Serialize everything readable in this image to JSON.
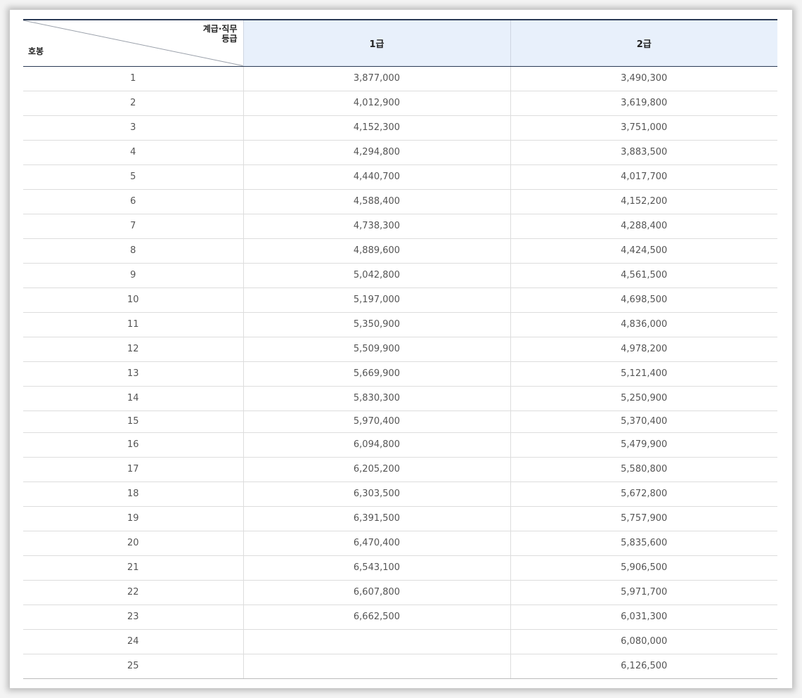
{
  "table": {
    "corner_top_line1": "계급·직무",
    "corner_top_line2": "등급",
    "corner_bottom": "호봉",
    "columns": [
      "1급",
      "2급"
    ],
    "rows": [
      {
        "step": "1",
        "grade1": "3,877,000",
        "grade2": "3,490,300"
      },
      {
        "step": "2",
        "grade1": "4,012,900",
        "grade2": "3,619,800"
      },
      {
        "step": "3",
        "grade1": "4,152,300",
        "grade2": "3,751,000"
      },
      {
        "step": "4",
        "grade1": "4,294,800",
        "grade2": "3,883,500"
      },
      {
        "step": "5",
        "grade1": "4,440,700",
        "grade2": "4,017,700"
      },
      {
        "step": "6",
        "grade1": "4,588,400",
        "grade2": "4,152,200"
      },
      {
        "step": "7",
        "grade1": "4,738,300",
        "grade2": "4,288,400"
      },
      {
        "step": "8",
        "grade1": "4,889,600",
        "grade2": "4,424,500"
      },
      {
        "step": "9",
        "grade1": "5,042,800",
        "grade2": "4,561,500"
      },
      {
        "step": "10",
        "grade1": "5,197,000",
        "grade2": "4,698,500"
      },
      {
        "step": "11",
        "grade1": "5,350,900",
        "grade2": "4,836,000"
      },
      {
        "step": "12",
        "grade1": "5,509,900",
        "grade2": "4,978,200"
      },
      {
        "step": "13",
        "grade1": "5,669,900",
        "grade2": "5,121,400"
      },
      {
        "step": "14",
        "grade1": "5,830,300",
        "grade2": "5,250,900"
      },
      {
        "step": "15",
        "grade1": "5,970,400",
        "grade2": "5,370,400"
      },
      {
        "step": "16",
        "grade1": "6,094,800",
        "grade2": "5,479,900"
      },
      {
        "step": "17",
        "grade1": "6,205,200",
        "grade2": "5,580,800"
      },
      {
        "step": "18",
        "grade1": "6,303,500",
        "grade2": "5,672,800"
      },
      {
        "step": "19",
        "grade1": "6,391,500",
        "grade2": "5,757,900"
      },
      {
        "step": "20",
        "grade1": "6,470,400",
        "grade2": "5,835,600"
      },
      {
        "step": "21",
        "grade1": "6,543,100",
        "grade2": "5,906,500"
      },
      {
        "step": "22",
        "grade1": "6,607,800",
        "grade2": "5,971,700"
      },
      {
        "step": "23",
        "grade1": "6,662,500",
        "grade2": "6,031,300"
      },
      {
        "step": "24",
        "grade1": "",
        "grade2": "6,080,000"
      },
      {
        "step": "25",
        "grade1": "",
        "grade2": "6,126,500"
      }
    ]
  }
}
